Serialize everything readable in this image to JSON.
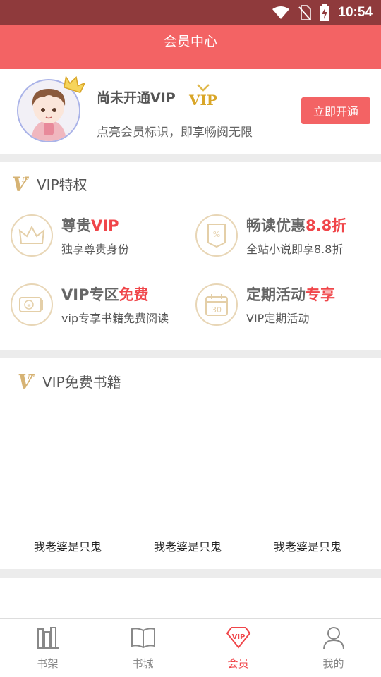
{
  "status_bar": {
    "time": "10:54",
    "icons": [
      "wifi-icon",
      "no-sim-icon",
      "battery-charging-icon"
    ]
  },
  "header": {
    "title": "会员中心"
  },
  "profile": {
    "status_text": "尚未开通VIP",
    "vip_badge": "VIP",
    "description": "点亮会员标识，即享畅阅无限",
    "open_button": "立即开通"
  },
  "privileges": {
    "title": "VIP特权",
    "items": [
      {
        "title_main": "尊贵",
        "title_highlight": "VIP",
        "subtitle": "独享尊贵身份",
        "icon": "crown-icon"
      },
      {
        "title_main": "畅读优惠",
        "title_highlight": "8.8折",
        "subtitle": "全站小说即享8.8折",
        "icon": "discount-icon"
      },
      {
        "title_main": "VIP专区",
        "title_highlight": "免费",
        "subtitle": "vip专享书籍免费阅读",
        "icon": "ticket-icon"
      },
      {
        "title_main": "定期活动",
        "title_highlight": "专享",
        "subtitle": "VIP定期活动",
        "icon": "calendar-icon"
      }
    ]
  },
  "free_books": {
    "title": "VIP免费书籍",
    "books": [
      {
        "title": "我老婆是只鬼"
      },
      {
        "title": "我老婆是只鬼"
      },
      {
        "title": "我老婆是只鬼"
      }
    ]
  },
  "tabbar": {
    "items": [
      {
        "label": "书架",
        "icon": "bookshelf-icon"
      },
      {
        "label": "书城",
        "icon": "book-icon"
      },
      {
        "label": "会员",
        "icon": "vip-diamond-icon",
        "active": true
      },
      {
        "label": "我的",
        "icon": "user-icon"
      }
    ]
  },
  "colors": {
    "accent": "#f36364",
    "highlight": "#f0464a",
    "gold": "#d6b374",
    "status_bar": "#8f3a3c"
  }
}
